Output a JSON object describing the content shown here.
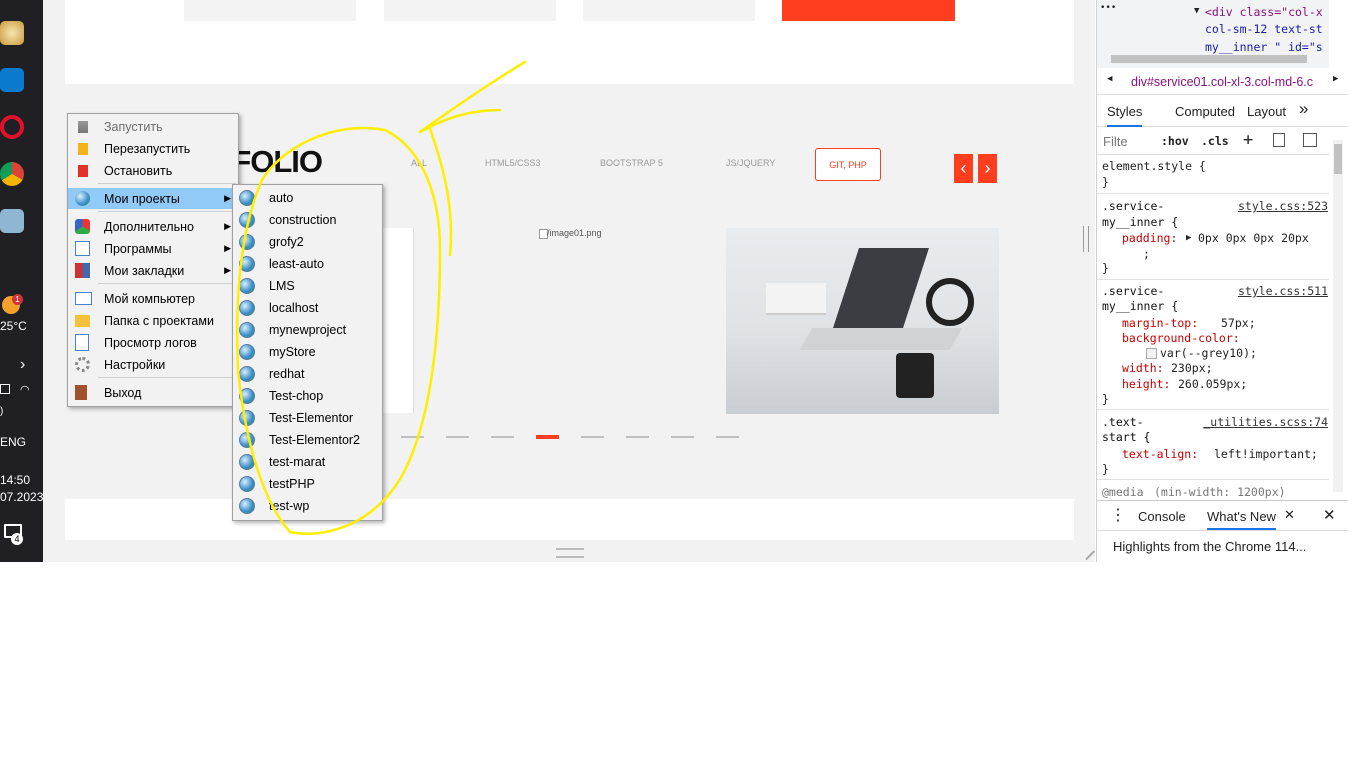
{
  "taskbar": {
    "weather_badge": "1",
    "temperature": "25°C",
    "language": "ENG",
    "time": "14:50",
    "date": "07.2023",
    "notifications": "4"
  },
  "page": {
    "portfolio_title": "RTFOLIO",
    "filters": [
      "ALL",
      "HTML5/CSS3",
      "BOOTSTRAP 5",
      "JS/JQUERY"
    ],
    "filter_active": "GIT, PHP",
    "prev_arrow": "‹",
    "next_arrow": "›",
    "broken_image_label": "/image01.png",
    "active_dash_color": "#ff3e1f"
  },
  "devtools": {
    "dom_dots": "•••",
    "dom_line1": "<div class=\"col-x",
    "dom_line2": "col-sm-12 text-st",
    "dom_line3": "my__inner \" id=\"s",
    "breadcrumb": "div#service01.col-xl-3.col-md-6.c",
    "tabs": [
      "Styles",
      "Computed",
      "Layout"
    ],
    "more_tabs": "»",
    "filter_placeholder": "Filte",
    "hov": ":hov",
    "cls": ".cls",
    "rules": {
      "element_style": "element.style {",
      "close": "}",
      "r1_sel1": ".service-",
      "r1_sel2": "my__inner {",
      "r1_src": "style.css:523",
      "r1_prop": "padding:",
      "r1_val": "0px 0px 0px 20px",
      "r1_semi": ";",
      "r2_sel1": ".service-",
      "r2_sel2": "my__inner {",
      "r2_src": "style.css:511",
      "r2_p1": "margin-top:",
      "r2_v1": "57px;",
      "r2_p2": "background-color:",
      "r2_v2": "var(--grey10);",
      "r2_p3": "width:",
      "r2_v3": "230px;",
      "r2_p4": "height:",
      "r2_v4": "260.059px;",
      "r3_sel1": ".text-",
      "r3_sel2": "start {",
      "r3_src": "_utilities.scss:74",
      "r3_prop": "text-align:",
      "r3_val": "left!important;",
      "media": "@media",
      "media_q": "(min-width: 1200px)"
    },
    "drawer_tabs": [
      "Console",
      "What's New"
    ],
    "drawer_text": "Highlights from the Chrome 114..."
  },
  "context_menu": {
    "items": [
      {
        "label": "Запустить",
        "disabled": true
      },
      {
        "label": "Перезапустить"
      },
      {
        "label": "Остановить"
      },
      {
        "label": "Мои проекты",
        "highlighted": true,
        "submenu": true
      },
      {
        "label": "Дополнительно",
        "submenu": true
      },
      {
        "label": "Программы",
        "submenu": true
      },
      {
        "label": "Мои закладки",
        "submenu": true
      },
      {
        "label": "Мой компьютер"
      },
      {
        "label": "Папка с проектами"
      },
      {
        "label": "Просмотр логов"
      },
      {
        "label": "Настройки"
      },
      {
        "label": "Выход"
      }
    ],
    "submenu_arrow": "▶"
  },
  "projects_submenu": {
    "items": [
      "auto",
      "construction",
      "grofy2",
      "least-auto",
      "LMS",
      "localhost",
      "mynewproject",
      "myStore",
      "redhat",
      "Test-chop",
      "Test-Elementor",
      "Test-Elementor2",
      "test-marat",
      "testPHP",
      "test-wp"
    ]
  }
}
